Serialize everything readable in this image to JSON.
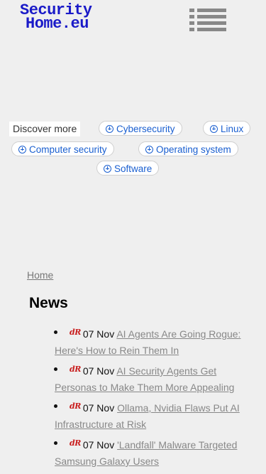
{
  "header": {
    "logo_line1": "Security",
    "logo_line2": "Home.eu"
  },
  "discover": {
    "label": "Discover more",
    "chips": [
      "Cybersecurity",
      "Linux",
      "Computer security",
      "Operating system",
      "Software"
    ]
  },
  "breadcrumb": {
    "home": "Home"
  },
  "news": {
    "title": "News",
    "items": [
      {
        "source": "dR",
        "date": "07 Nov",
        "title": "AI Agents Are Going Rogue: Here's How to Rein Them In"
      },
      {
        "source": "dR",
        "date": "07 Nov",
        "title": "AI Security Agents Get Personas to Make Them More Appealing"
      },
      {
        "source": "dR",
        "date": "07 Nov",
        "title": "Ollama, Nvidia Flaws Put AI Infrastructure at Risk"
      },
      {
        "source": "dR",
        "date": "07 Nov",
        "title": "'Landfall' Malware Targeted Samsung Galaxy Users"
      }
    ]
  },
  "colors": {
    "logo": "#1a1ac8",
    "chip_text": "#1a5fd0",
    "badge": "#c81c1c"
  }
}
